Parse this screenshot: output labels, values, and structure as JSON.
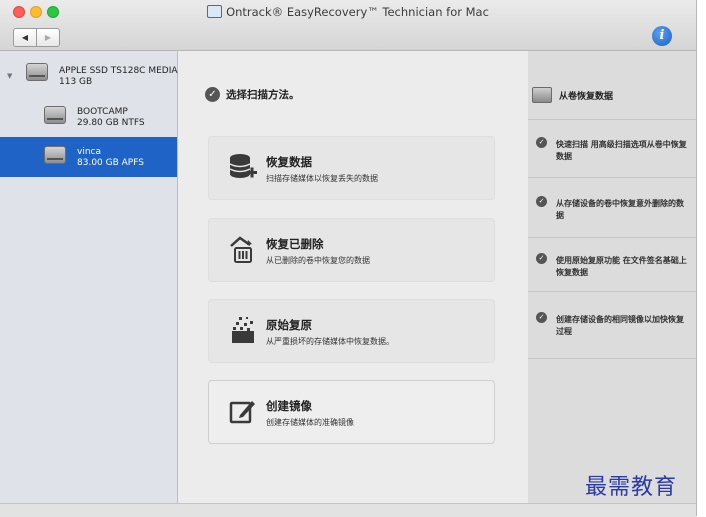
{
  "window": {
    "title": "Ontrack® EasyRecovery™ Technician for Mac",
    "info_label": "i",
    "nav_back": "◀",
    "nav_forward": "▶"
  },
  "sidebar": {
    "disks": [
      {
        "name": "APPLE SSD TS128C MEDIA",
        "size": "113  GB",
        "expanded": true
      },
      {
        "name": "BOOTCAMP",
        "size": "29.80 GB NTFS"
      },
      {
        "name": "vinca",
        "size": "83.00 GB APFS",
        "selected": true
      }
    ]
  },
  "main": {
    "heading": "选择扫描方法。",
    "actions": [
      {
        "label": "恢复数据",
        "desc": "扫描存储媒体以恢复丢失的数据"
      },
      {
        "label": "恢复已删除",
        "desc": "从已删除的卷中恢复您的数据"
      },
      {
        "label": "原始复原",
        "desc": "从严重损坏的存储媒体中恢复数据。"
      },
      {
        "label": "创建镜像",
        "desc": "创建存储媒体的准确镜像"
      }
    ]
  },
  "right_panel": {
    "title": "从卷恢复数据",
    "items": [
      "快速扫描 用高级扫描选项从卷中恢复数据",
      "从存储设备的卷中恢复意外删除的数据",
      "使用原始复原功能 在文件签名基础上恢复数据",
      "创建存储设备的相同镜像以加快恢复过程"
    ]
  },
  "watermark": "最需教育",
  "colors": {
    "selection": "#1f63c6",
    "close": "#fc5f57",
    "minimize": "#fdbc2e",
    "zoom": "#29c840",
    "info": "#1a5fc4"
  }
}
